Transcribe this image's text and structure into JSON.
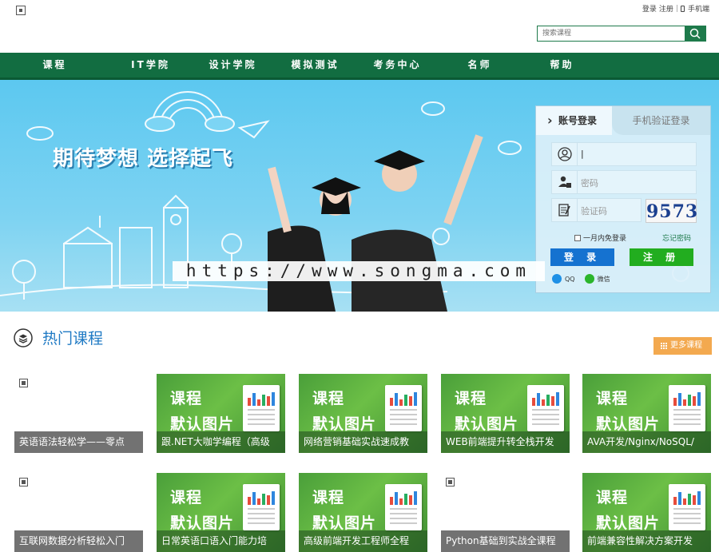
{
  "header": {
    "login_link": "登录",
    "register_link": "注册",
    "mobile_link": "手机端",
    "search_placeholder": "搜索课程"
  },
  "nav": [
    "课程",
    "IT学院",
    "设计学院",
    "模拟测试",
    "考务中心",
    "名师",
    "帮助"
  ],
  "banner": {
    "slogan": "期待梦想  选择起飞",
    "watermark": "https://www.songma.com"
  },
  "login": {
    "tab_account": "账号登录",
    "tab_phone": "手机验证登录",
    "username_value": "|",
    "password_placeholder": "密码",
    "captcha_placeholder": "验证码",
    "captcha_code": "9573",
    "remember_label": "一月内免登录",
    "forgot_label": "忘记密码",
    "login_button": "登 录",
    "register_button": "注 册",
    "qq_label": "QQ",
    "wechat_label": "微信"
  },
  "hot": {
    "title": "热门课程",
    "more_label": "更多课程"
  },
  "default_image": {
    "line1": "课程",
    "line2": "默认图片"
  },
  "courses": [
    {
      "title": "英语语法轻松学——零点",
      "image": "blank"
    },
    {
      "title": "跟.NET大咖学编程（高级",
      "image": "default"
    },
    {
      "title": "网络营销基础实战速成教",
      "image": "default"
    },
    {
      "title": "WEB前端提升转全栈开发",
      "image": "default"
    },
    {
      "title": "AVA开发/Nginx/NoSQL/",
      "image": "default"
    },
    {
      "title": "互联网数据分析轻松入门",
      "image": "blank"
    },
    {
      "title": "日常英语口语入门能力培",
      "image": "default"
    },
    {
      "title": "高级前端开发工程师全程",
      "image": "default"
    },
    {
      "title": "Python基础到实战全课程",
      "image": "blank"
    },
    {
      "title": "前端兼容性解决方案开发",
      "image": "default"
    }
  ],
  "colors": {
    "nav_green": "#126d41",
    "login_blue": "#1572d0",
    "register_green": "#22ad1f",
    "title_blue": "#1f7ac4",
    "more_orange": "#f3a94f"
  }
}
